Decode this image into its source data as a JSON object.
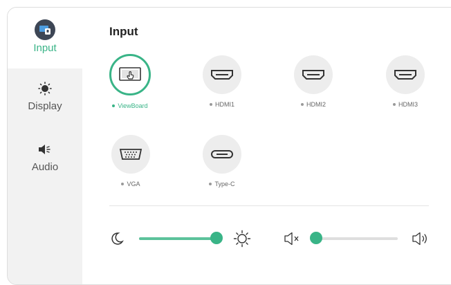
{
  "sidebar": {
    "items": [
      {
        "label": "Input",
        "icon": "input-source-icon",
        "active": true
      },
      {
        "label": "Display",
        "icon": "brightness-sun-icon",
        "active": false
      },
      {
        "label": "Audio",
        "icon": "speaker-icon",
        "active": false
      }
    ]
  },
  "main": {
    "title": "Input",
    "sources": [
      {
        "label": "ViewBoard",
        "icon": "viewboard-touch-icon",
        "selected": true
      },
      {
        "label": "HDMI1",
        "icon": "hdmi-port-icon",
        "selected": false
      },
      {
        "label": "HDMI2",
        "icon": "hdmi-port-icon",
        "selected": false
      },
      {
        "label": "HDMI3",
        "icon": "hdmi-port-icon",
        "selected": false
      },
      {
        "label": "VGA",
        "icon": "vga-port-icon",
        "selected": false
      },
      {
        "label": "Type-C",
        "icon": "usb-type-c-icon",
        "selected": false
      }
    ]
  },
  "controls": {
    "brightness": {
      "level": 0.95,
      "min_icon": "moon-icon",
      "max_icon": "sun-icon"
    },
    "volume": {
      "level": 0.03,
      "min_icon": "volume-mute-icon",
      "max_icon": "volume-up-icon"
    }
  },
  "colors": {
    "accent": "#39b487",
    "slider_fill": "#5cc29b",
    "sidebar_bg": "#f2f2f2",
    "icon_dark": "#3d4655"
  }
}
